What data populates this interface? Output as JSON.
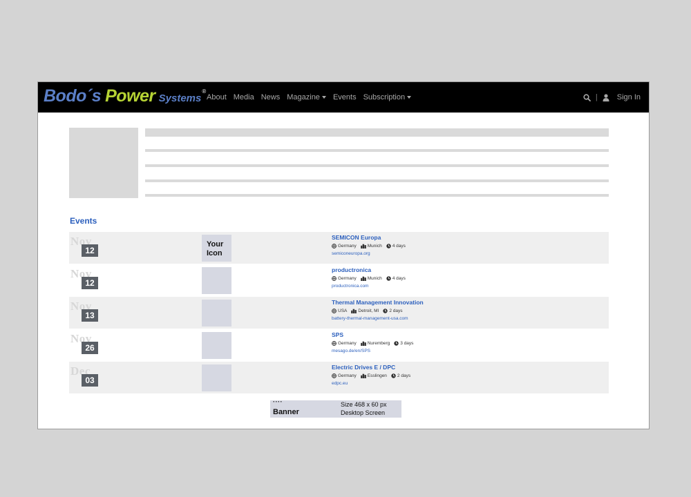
{
  "brand": {
    "logo_text_1": "Bodo´s",
    "logo_text_2": "Power",
    "logo_text_3": "Systems",
    "logo_reg": "®"
  },
  "nav": {
    "items": [
      {
        "label": "About",
        "dropdown": false
      },
      {
        "label": "Media",
        "dropdown": false
      },
      {
        "label": "News",
        "dropdown": false
      },
      {
        "label": "Magazine",
        "dropdown": true
      },
      {
        "label": "Events",
        "dropdown": false
      },
      {
        "label": "Subscription",
        "dropdown": true
      }
    ],
    "search_icon": "search-icon",
    "separator": "|",
    "user_icon": "user-icon",
    "sign_in": "Sign In"
  },
  "events": {
    "heading": "Events",
    "placeholder_icon_label": "Your Icon",
    "rows": [
      {
        "month": "Nov",
        "day": "12",
        "title": "SEMICON Europa",
        "country": "Germany",
        "city": "Munich",
        "duration": "4 days",
        "url": "semiconeuropa.org",
        "show_icon_label": true
      },
      {
        "month": "Nov",
        "day": "12",
        "title": "productronica",
        "country": "Germany",
        "city": "Munich",
        "duration": "4 days",
        "url": "productronica.com",
        "show_icon_label": false
      },
      {
        "month": "Nov",
        "day": "13",
        "title": "Thermal Management Innovation",
        "country": "USA",
        "city": "Detroit, MI",
        "duration": "2 days",
        "url": "battery-thermal-management-usa.com",
        "show_icon_label": false
      },
      {
        "month": "Nov",
        "day": "26",
        "title": "SPS",
        "country": "Germany",
        "city": "Nuremberg",
        "duration": "3 days",
        "url": "mesago.de/en/SPS",
        "show_icon_label": false
      },
      {
        "month": "Dec",
        "day": "03",
        "title": "Electric Drives E / DPC",
        "country": "Germany",
        "city": "Esslingen",
        "duration": "2 days",
        "url": "edpc.eu",
        "show_icon_label": false
      }
    ]
  },
  "banner": {
    "dots": "····",
    "label": "Banner",
    "size": "Size 468 x 60 px",
    "screen": "Desktop Screen"
  },
  "colors": {
    "page_bg": "#d4d4d4",
    "navbar_bg": "#000000",
    "link": "#2b5fbd",
    "logo_blue": "#5b7fc7",
    "logo_green": "#b6d334",
    "day_badge": "#5a5f66",
    "placeholder": "#d6d8e2"
  }
}
